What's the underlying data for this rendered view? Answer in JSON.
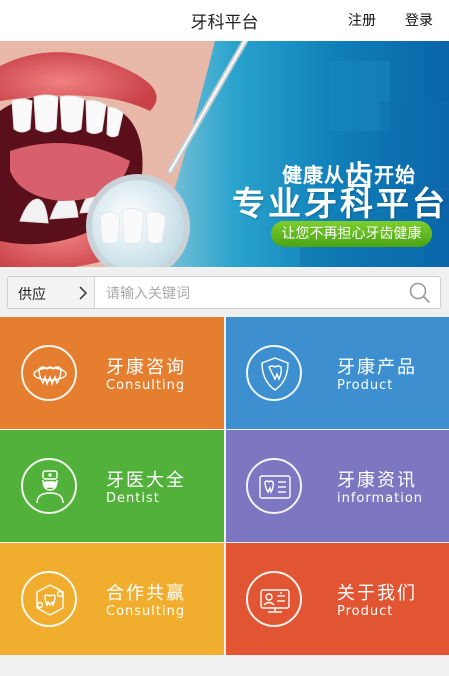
{
  "header": {
    "title": "牙科平台",
    "register": "注册",
    "login": "登录"
  },
  "banner": {
    "slogan_part1": "健康从",
    "slogan_highlight": "齿",
    "slogan_part2": "开始",
    "headline": "专业牙科平台",
    "tagline": "让您不再担心牙齿健康"
  },
  "search": {
    "category": "供应",
    "placeholder": "请输入关键词"
  },
  "tiles": [
    {
      "title": "牙康咨询",
      "subtitle": "Consulting",
      "icon": "teeth-icon",
      "color": "#e57f2f"
    },
    {
      "title": "牙康产品",
      "subtitle": "Product",
      "icon": "tooth-shield-icon",
      "color": "#3d8fd0"
    },
    {
      "title": "牙医大全",
      "subtitle": "Dentist",
      "icon": "dentist-icon",
      "color": "#52b13b"
    },
    {
      "title": "牙康资讯",
      "subtitle": "information",
      "icon": "tooth-card-icon",
      "color": "#7c77c0"
    },
    {
      "title": "合作共赢",
      "subtitle": "Consulting",
      "icon": "molecule-icon",
      "color": "#f1ae2e"
    },
    {
      "title": "关于我们",
      "subtitle": "Product",
      "icon": "profile-card-icon",
      "color": "#e25533"
    }
  ]
}
